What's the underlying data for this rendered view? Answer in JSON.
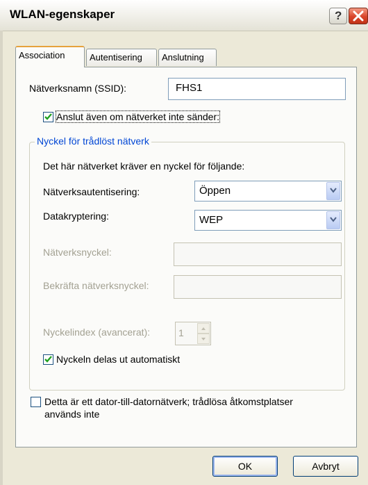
{
  "window": {
    "title": "WLAN-egenskaper",
    "help_symbol": "?"
  },
  "tabs": [
    {
      "label": "Association",
      "active": true
    },
    {
      "label": "Autentisering",
      "active": false
    },
    {
      "label": "Anslutning",
      "active": false
    }
  ],
  "ssid": {
    "label": "Nätverksnamn (SSID):",
    "value": "FHS1"
  },
  "broadcast_checkbox": {
    "label": "Anslut även om nätverket inte sänder:",
    "checked": true
  },
  "key_group": {
    "legend": "Nyckel för trådlöst nätverk",
    "description": "Det här nätverket kräver en nyckel för följande:",
    "auth_label": "Nätverksautentisering:",
    "auth_value": "Öppen",
    "enc_label": "Datakryptering:",
    "enc_value": "WEP",
    "key_label": "Nätverksnyckel:",
    "key_value": "",
    "confirm_label": "Bekräfta nätverksnyckel:",
    "confirm_value": "",
    "index_label": "Nyckelindex (avancerat):",
    "index_value": "1",
    "auto_key_label": "Nyckeln delas ut automatiskt",
    "auto_key_checked": true
  },
  "adhoc_checkbox": {
    "line1": "Detta är ett dator-till-datornätverk; trådlösa åtkomstplatser",
    "line2": "används inte",
    "checked": false
  },
  "buttons": {
    "ok": "OK",
    "cancel": "Avbryt"
  },
  "colors": {
    "accent_blue": "#0046d5",
    "tab_highlight": "#e6a23c",
    "close_red": "#d9442a",
    "check_green": "#21a121"
  }
}
